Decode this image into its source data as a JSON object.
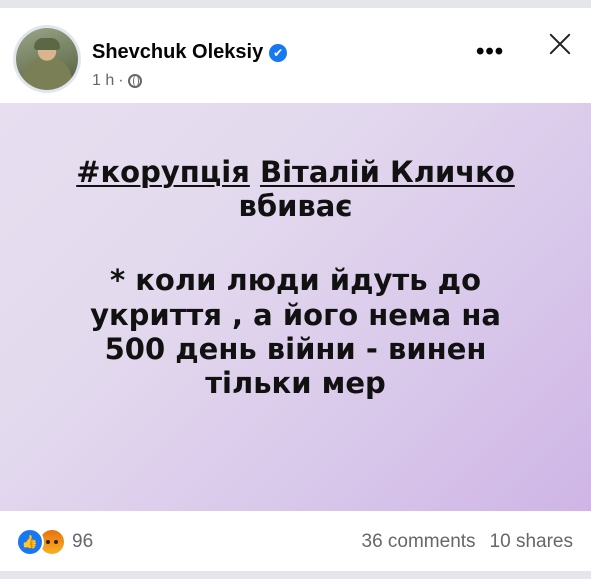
{
  "header": {
    "author_name": "Shevchuk Oleksiy",
    "verified_icon": "✔",
    "time": "1 h",
    "separator": "·",
    "more_icon": "•••"
  },
  "post": {
    "line1_hashtag": "#корупція",
    "line1_name": "Віталій Кличко",
    "line2": "вбиває",
    "line3": "* коли люди йдуть до",
    "line4": "укриття , а його нема на",
    "line5": "500 день війни - винен",
    "line6": "тільки мер"
  },
  "footer": {
    "reaction_count": "96",
    "comments": "36 comments",
    "shares": "10 shares"
  },
  "colors": {
    "accent": "#1877f2",
    "muted_text": "#65676b",
    "post_bg_start": "#e7dff0",
    "post_bg_end": "#cfb5e6"
  }
}
